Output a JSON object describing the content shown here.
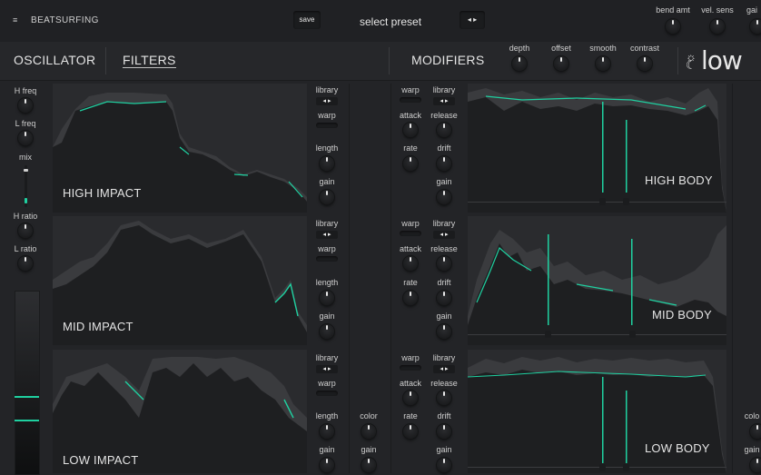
{
  "topbar": {
    "menu_icon": "≡",
    "brand": "BEATSURFING",
    "save": "save",
    "preset": "select preset",
    "arrows": "◂ ▸",
    "knobs": [
      "bend amt",
      "vel. sens",
      "gai"
    ]
  },
  "navbar": {
    "tab_oscillator": "OSCILLATOR",
    "tab_filters": "FILTERS",
    "tab_modifiers": "MODIFIERS",
    "mod_knobs": [
      "depth",
      "offset",
      "smooth",
      "contrast"
    ],
    "logo": "low"
  },
  "sidebar": {
    "h_freq": "H freq",
    "l_freq": "L freq",
    "mix": "mix",
    "h_ratio": "H ratio",
    "l_ratio": "L ratio"
  },
  "impact": {
    "titles": [
      "HIGH IMPACT",
      "MID IMPACT",
      "LOW IMPACT"
    ],
    "library": "library",
    "warp": "warp",
    "length": "length",
    "gain": "gain",
    "arrows": "◂ ▸"
  },
  "mid": {
    "color": "color",
    "gain": "gain"
  },
  "body": {
    "titles": [
      "HIGH BODY",
      "MID BODY",
      "LOW BODY"
    ],
    "warp": "warp",
    "library": "library",
    "attack": "attack",
    "release": "release",
    "rate": "rate",
    "drift": "drift",
    "gain": "gain",
    "arrows": "◂ ▸"
  },
  "right_edge": {
    "color": "colo",
    "gain": "gain"
  },
  "colors": {
    "accent": "#1fd0a0",
    "bg": "#232427",
    "panel": "#2a2b2e"
  }
}
